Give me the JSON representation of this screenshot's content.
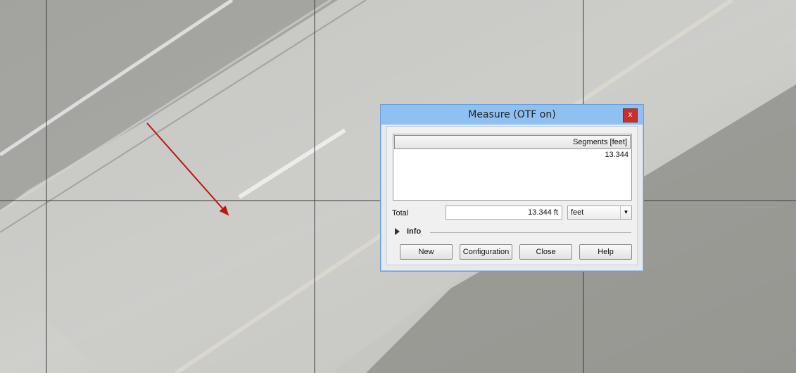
{
  "dialog": {
    "title": "Measure (OTF on)",
    "close_label": "x",
    "segments_header": "Segments [feet]",
    "segments": [
      "13.344"
    ],
    "total_label": "Total",
    "total_value": "13.344 ft",
    "unit_selected": "feet",
    "info_label": "Info",
    "buttons": {
      "new": "New",
      "configuration": "Configuration",
      "close": "Close",
      "help": "Help"
    }
  },
  "colors": {
    "titlebar": "#8fc0f2",
    "arrow": "#c0160f",
    "close_button": "#c9302c"
  }
}
